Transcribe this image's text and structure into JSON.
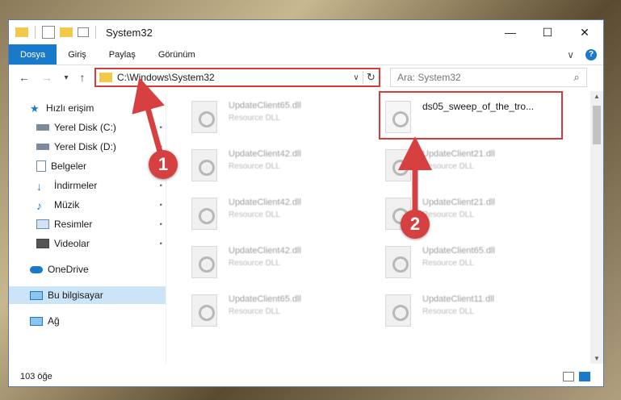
{
  "window": {
    "title": "System32",
    "controls": {
      "minimize": "—",
      "maximize": "☐",
      "close": "✕"
    }
  },
  "ribbon": {
    "tabs": [
      "Dosya",
      "Giriş",
      "Paylaş",
      "Görünüm"
    ],
    "expand": "∨",
    "help": "?"
  },
  "nav": {
    "back": "←",
    "forward": "→",
    "recent": "▾",
    "up": "↑",
    "address": "C:\\Windows\\System32",
    "address_dropdown": "∨",
    "refresh": "↻",
    "search_placeholder": "Ara: System32",
    "search_icon": "⌕"
  },
  "sidebar": {
    "items": [
      {
        "label": "Hızlı erişim",
        "icon": "star-icon",
        "pinned": false
      },
      {
        "label": "Yerel Disk (C:)",
        "icon": "drive-icon",
        "pinned": true
      },
      {
        "label": "Yerel Disk (D:)",
        "icon": "drive-icon",
        "pinned": true
      },
      {
        "label": "Belgeler",
        "icon": "document-icon",
        "pinned": true
      },
      {
        "label": "İndirmeler",
        "icon": "download-icon",
        "pinned": true
      },
      {
        "label": "Müzik",
        "icon": "music-icon",
        "pinned": true
      },
      {
        "label": "Resimler",
        "icon": "pictures-icon",
        "pinned": true
      },
      {
        "label": "Videolar",
        "icon": "videos-icon",
        "pinned": true
      },
      {
        "label": "OneDrive",
        "icon": "cloud-icon",
        "pinned": false
      },
      {
        "label": "Bu bilgisayar",
        "icon": "computer-icon",
        "pinned": false,
        "selected": true
      },
      {
        "label": "Ağ",
        "icon": "network-icon",
        "pinned": false
      }
    ],
    "pin_glyph": "📌"
  },
  "files": {
    "left_column": [
      {
        "name": "UpdateClient65.dll",
        "type": "Resource DLL"
      },
      {
        "name": "UpdateClient42.dll",
        "type": "Resource DLL"
      },
      {
        "name": "UpdateClient42.dll",
        "type": "Resource DLL"
      },
      {
        "name": "UpdateClient42.dll",
        "type": "Resource DLL"
      },
      {
        "name": "UpdateClient65.dll",
        "type": "Resource DLL"
      }
    ],
    "right_column": [
      {
        "name": "ds05_sweep_of_the_tro...",
        "type": "",
        "highlighted": true
      },
      {
        "name": "UpdateClient21.dll",
        "type": "Resource DLL"
      },
      {
        "name": "UpdateClient21.dll",
        "type": "Resource DLL"
      },
      {
        "name": "UpdateClient65.dll",
        "type": "Resource DLL"
      },
      {
        "name": "UpdateClient11.dll",
        "type": "Resource DLL"
      }
    ]
  },
  "status": {
    "item_count": "103 öğe"
  },
  "callouts": [
    "1",
    "2"
  ],
  "colors": {
    "accent": "#1979ca",
    "highlight": "#d63b3b",
    "callout": "#d64040"
  }
}
